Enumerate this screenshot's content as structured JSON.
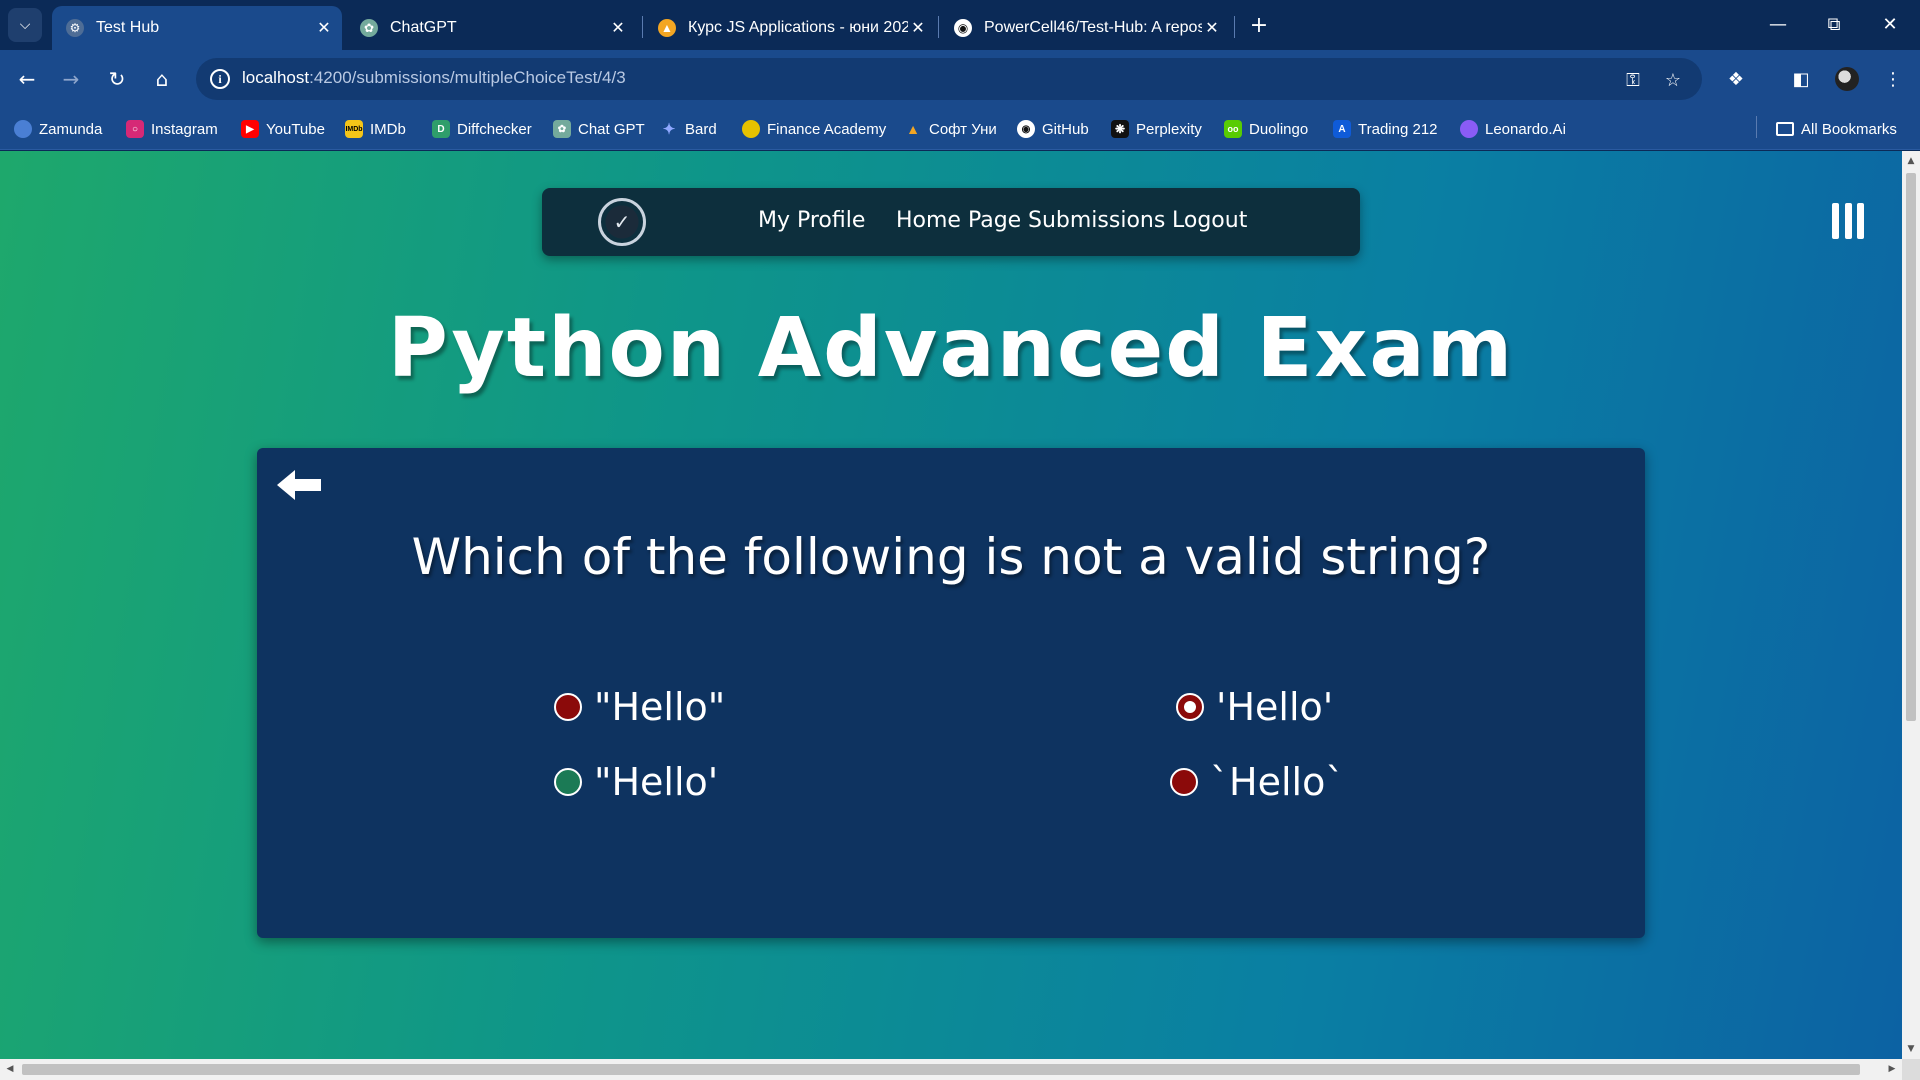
{
  "browser": {
    "tabs": [
      {
        "title": "Test Hub",
        "icon": "testhub-icon"
      },
      {
        "title": "ChatGPT",
        "icon": "chatgpt-icon"
      },
      {
        "title": "Курс JS Applications - юни 202",
        "icon": "softuni-icon"
      },
      {
        "title": "PowerCell46/Test-Hub: A reposi",
        "icon": "github-icon"
      }
    ],
    "url_host": "localhost",
    "url_path": ":4200/submissions/multipleChoiceTest/4/3",
    "bookmarks": [
      {
        "label": "Zamunda",
        "color": "#4a7fd4"
      },
      {
        "label": "Instagram",
        "color": "#d62976"
      },
      {
        "label": "YouTube",
        "color": "#ff0000"
      },
      {
        "label": "IMDb",
        "color": "#f5c518"
      },
      {
        "label": "Diffchecker",
        "color": "#2f9e6b"
      },
      {
        "label": "Chat GPT",
        "color": "#74aa9c"
      },
      {
        "label": "Bard",
        "color": "#6b8cff"
      },
      {
        "label": "Finance Academy",
        "color": "#e6c200"
      },
      {
        "label": "Софт Уни",
        "color": "#f3a623"
      },
      {
        "label": "GitHub",
        "color": "#24292e"
      },
      {
        "label": "Perplexity",
        "color": "#20808d"
      },
      {
        "label": "Duolingo",
        "color": "#58cc02"
      },
      {
        "label": "Trading 212",
        "color": "#0f5bd8"
      },
      {
        "label": "Leonardo.Ai",
        "color": "#8a5cf6"
      }
    ],
    "all_bookmarks_label": "All Bookmarks"
  },
  "app": {
    "nav": {
      "links": [
        "My Profile",
        "Home Page",
        "Submissions",
        "Logout"
      ]
    },
    "title": "Python Advanced Exam",
    "question": "Which of the following is not a valid string?",
    "options": [
      {
        "label": "\"Hello\"",
        "fill": "#8b0a0a",
        "selected": false
      },
      {
        "label": "'Hello'",
        "fill": "#8b0a0a",
        "selected": true
      },
      {
        "label": "\"Hello'",
        "fill": "#1b7a55",
        "selected": false
      },
      {
        "label": "`Hello`",
        "fill": "#8b0a0a",
        "selected": false
      }
    ]
  },
  "colors": {
    "wrong": "#8b0a0a",
    "correct": "#1b7a55",
    "card": "#0e3360",
    "nav": "#0d2f3d"
  }
}
